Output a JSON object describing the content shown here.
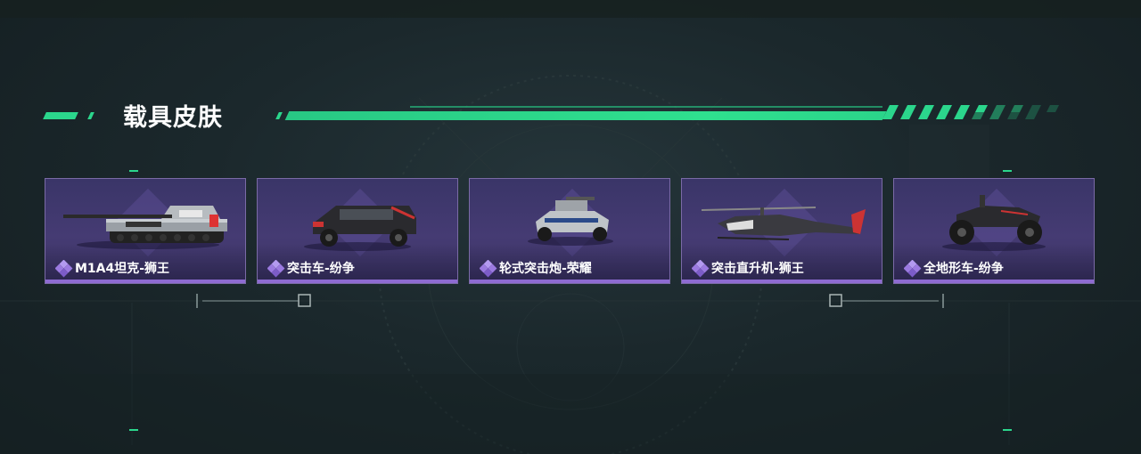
{
  "section": {
    "title": "载具皮肤"
  },
  "skins": [
    {
      "name": "M1A4坦克-狮王",
      "icon": "tank-icon"
    },
    {
      "name": "突击车-纷争",
      "icon": "assault-vehicle-icon"
    },
    {
      "name": "轮式突击炮-荣耀",
      "icon": "wheeled-gun-icon"
    },
    {
      "name": "突击直升机-狮王",
      "icon": "helicopter-icon"
    },
    {
      "name": "全地形车-纷争",
      "icon": "atv-icon"
    }
  ],
  "colors": {
    "accent": "#2bd68c",
    "card_bg": "#453b73",
    "card_border": "#7a6aa6",
    "rarity": "#9b7ae0"
  }
}
